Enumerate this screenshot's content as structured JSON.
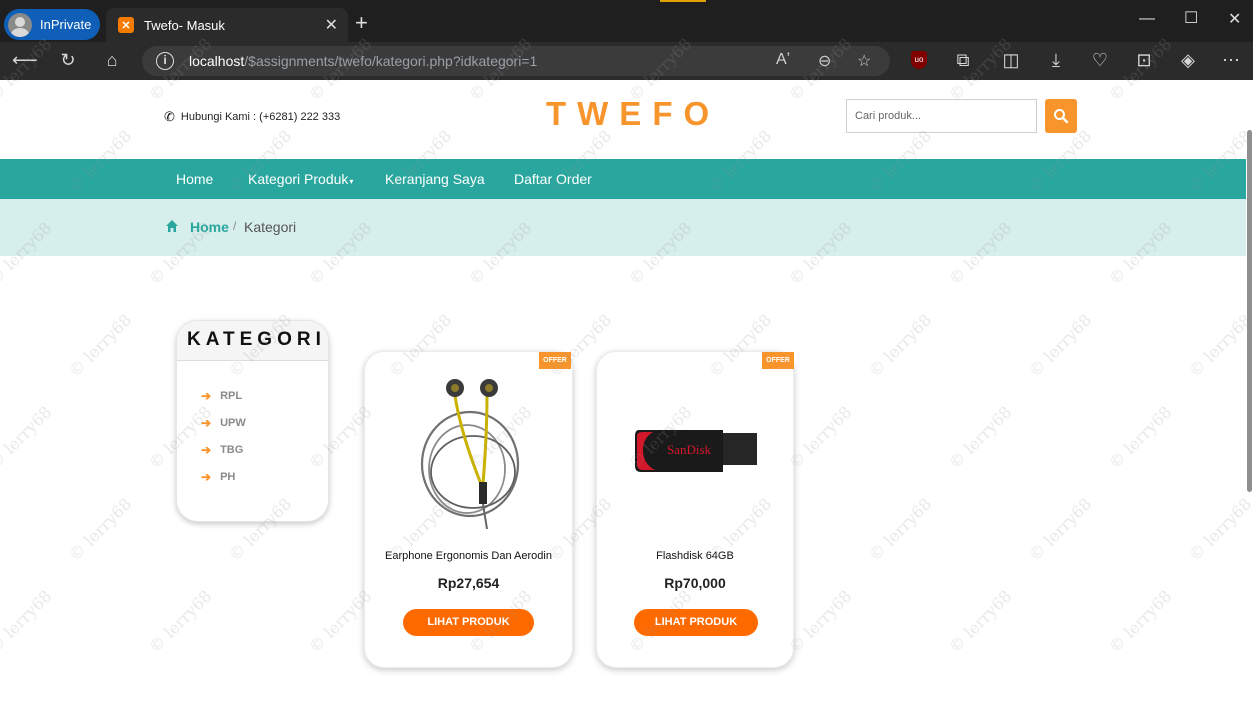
{
  "browser": {
    "inprivate_label": "InPrivate",
    "tab_title": "Twefo- Masuk",
    "tab_favicon": "xampp-icon",
    "url_host": "localhost",
    "url_path": "/$assignments/twefo/kategori.php?idkategori=1"
  },
  "header": {
    "hotline": "Hubungi Kami : (+6281) 222 333",
    "brand": "TWEFO",
    "search_placeholder": "Cari produk..."
  },
  "nav": {
    "items": [
      "Home",
      "Kategori Produk",
      "Keranjang Saya",
      "Daftar Order"
    ]
  },
  "breadcrumb": {
    "home": "Home",
    "separator": "/",
    "current": "Kategori"
  },
  "sidebar": {
    "title": "KATEGORI",
    "items": [
      "RPL",
      "UPW",
      "TBG",
      "PH"
    ]
  },
  "products": [
    {
      "badge": "OFFER",
      "name": "Earphone Ergonomis Dan Aerodin",
      "price": "Rp27,654",
      "button": "LIHAT PRODUK"
    },
    {
      "badge": "OFFER",
      "name": "Flashdisk 64GB",
      "price": "Rp70,000",
      "button": "LIHAT PRODUK",
      "image_text": "SanDisk"
    }
  ],
  "watermark": "© lerry68",
  "colors": {
    "accent": "#f7942c",
    "nav": "#29a79e",
    "breadcrumb_bg": "#d6eeec",
    "button": "#ff6a00"
  }
}
